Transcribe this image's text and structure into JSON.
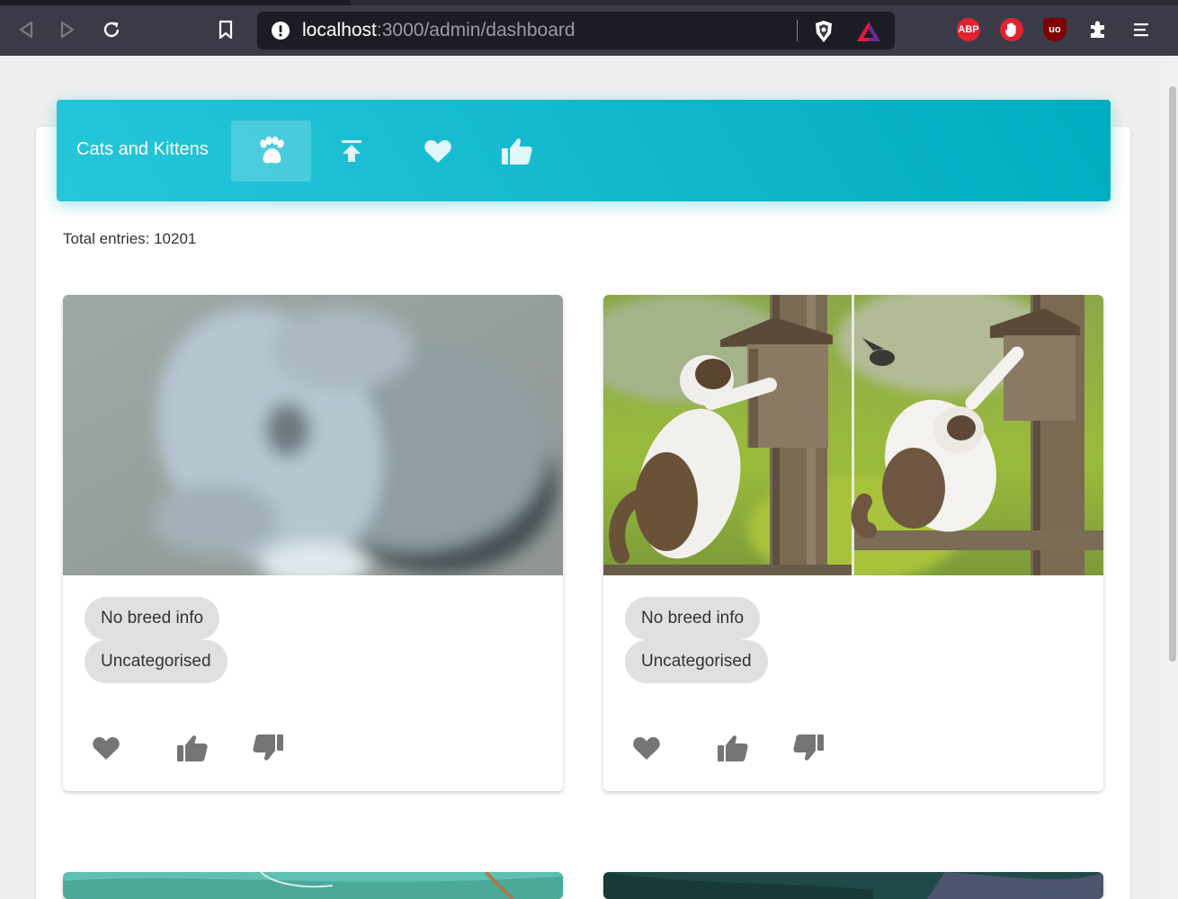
{
  "browser": {
    "url_host": "localhost",
    "url_path": ":3000/admin/dashboard",
    "extensions": {
      "abp_label": "ABP",
      "ublock_label": "uo"
    }
  },
  "header": {
    "brand": "Cats and Kittens",
    "tabs": [
      {
        "icon": "paw-icon",
        "active": true
      },
      {
        "icon": "upload-icon",
        "active": false
      },
      {
        "icon": "heart-icon",
        "active": false
      },
      {
        "icon": "thumbs-up-icon",
        "active": false
      }
    ]
  },
  "summary": {
    "total_label": "Total entries: 10201"
  },
  "entries": [
    {
      "breed": "No breed info",
      "category": "Uncategorised",
      "image": "blurred grey cat close-up"
    },
    {
      "breed": "No breed info",
      "category": "Uncategorised",
      "image": "ragdoll cats at birdhouse"
    }
  ],
  "colors": {
    "header_start": "#26c6da",
    "header_end": "#00acc1",
    "action_icon": "#757575",
    "chip_bg": "#e0e0e0"
  }
}
